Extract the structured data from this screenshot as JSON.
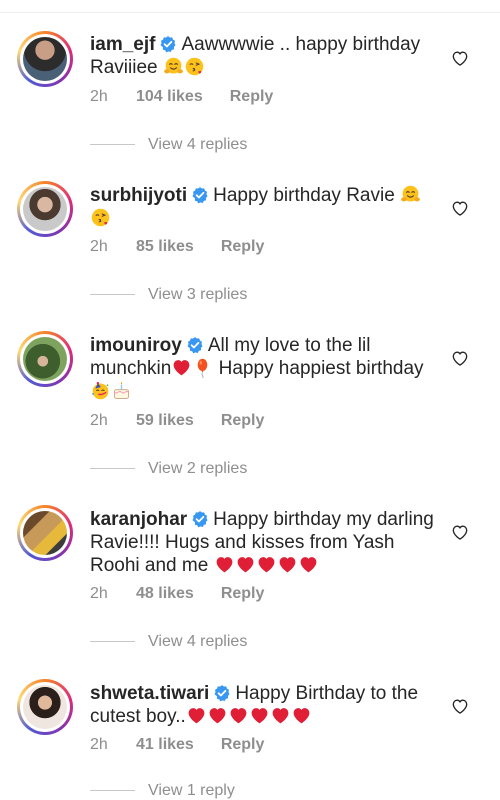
{
  "comments": [
    {
      "username": "iam_ejf",
      "text": "Aawwwwie .. happy birthday Raviiiee",
      "emojis": [
        "hugging-face",
        "face-blowing-kiss"
      ],
      "time": "2h",
      "likes": "104 likes",
      "reply": "Reply",
      "view_replies": "View 4 replies"
    },
    {
      "username": "surbhijyoti",
      "text": "Happy birthday Ravie",
      "emojis": [
        "hugging-face",
        "face-blowing-kiss"
      ],
      "time": "2h",
      "likes": "85 likes",
      "reply": "Reply",
      "view_replies": "View 3 replies"
    },
    {
      "username": "imouniroy",
      "text_1": "All my love to the lil munchkin",
      "text_2": "Happy happiest birthday",
      "emojis": [
        "red-heart",
        "balloon",
        "partying-face",
        "birthday-cake"
      ],
      "time": "2h",
      "likes": "59 likes",
      "reply": "Reply",
      "view_replies": "View 2 replies"
    },
    {
      "username": "karanjohar",
      "text": "Happy birthday my darling Ravie!!!! Hugs and kisses from Yash Roohi and me",
      "emojis": [
        "red-heart",
        "red-heart",
        "red-heart",
        "red-heart",
        "red-heart"
      ],
      "time": "2h",
      "likes": "48 likes",
      "reply": "Reply",
      "view_replies": "View 4 replies"
    },
    {
      "username": "shweta.tiwari",
      "text": "Happy Birthday to the cutest boy..",
      "emojis": [
        "red-heart",
        "red-heart",
        "red-heart",
        "red-heart",
        "red-heart",
        "red-heart"
      ],
      "time": "2h",
      "likes": "41 likes",
      "reply": "Reply",
      "view_replies": "View 1 reply"
    }
  ],
  "colors": {
    "text": "#262626",
    "secondary": "#8e8e8e",
    "verified": "#3897f0",
    "heart": "#ed4956"
  }
}
